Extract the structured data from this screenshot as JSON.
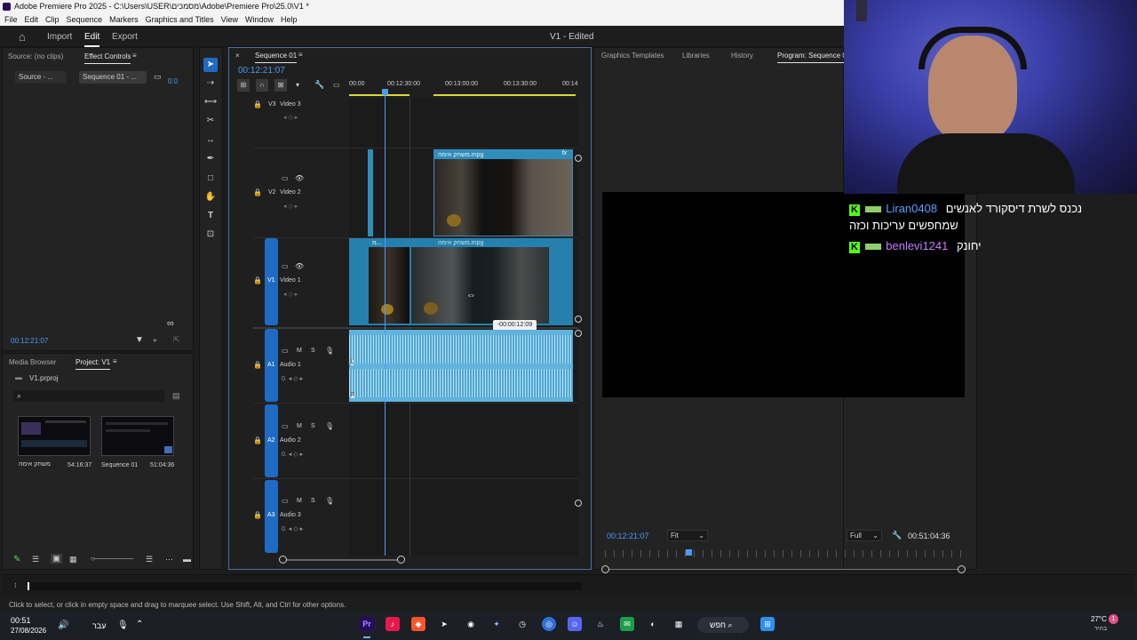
{
  "window": {
    "title": "Adobe Premiere Pro 2025 - C:\\Users\\USER\\מסמכים\\Adobe\\Premiere Pro\\25.0\\V1 *"
  },
  "menu": [
    "File",
    "Edit",
    "Clip",
    "Sequence",
    "Markers",
    "Graphics and Titles",
    "View",
    "Window",
    "Help"
  ],
  "workspace_tabs": {
    "import": "Import",
    "edit": "Edit",
    "export": "Export",
    "project_state": "V1 - Edited"
  },
  "source_panel": {
    "tab_source": "Source: (no clips)",
    "tab_effect": "Effect Controls",
    "source_drop": "Source - ...",
    "seq_drop": "Sequence 01 - ...",
    "timecode": "00:12:21:07",
    "edge_tc": "0:0"
  },
  "project_panel": {
    "tab_media": "Media Browser",
    "tab_project": "Project: V1",
    "file": "V1.prproj",
    "items": [
      {
        "name": "משחק אימה",
        "duration": "54:16:37"
      },
      {
        "name": "Sequence 01",
        "duration": "51:04:36"
      }
    ]
  },
  "timeline": {
    "tab": "Sequence 01",
    "timecode": "00:12:21:07",
    "ruler": [
      "00:00",
      "00:12:30:00",
      "00:13:00:00",
      "00:13:30:00",
      "00:14"
    ],
    "tracks": [
      {
        "id": "V3",
        "name": "Video 3"
      },
      {
        "id": "V2",
        "name": "Video 2"
      },
      {
        "id": "V1",
        "name": "Video 1"
      },
      {
        "id": "A1",
        "name": "Audio 1"
      },
      {
        "id": "A2",
        "name": "Audio 2"
      },
      {
        "id": "A3",
        "name": "Audio 3"
      }
    ],
    "clip_v2": "משחק אימה.mpg",
    "clip_v1": "משחק אימה.mpg",
    "clip_small": "מ...",
    "tooltip": "-00:00:12:09",
    "fx": "fx"
  },
  "program": {
    "tabs": [
      "Graphics Templates",
      "Libraries",
      "History",
      "Program: Sequence 01"
    ],
    "timecode": "00:12:21:07",
    "fit": "Fit",
    "quality": "Full",
    "duration": "00:51:04:36"
  },
  "chat": [
    {
      "user": "Liran0408",
      "text": "נכנס לשרת דיסקורד לאנשים",
      "text2": "שמחפשים עריכות וכזה",
      "color": "#5aa0ff"
    },
    {
      "user": "benlevi1241",
      "text": "יחונק",
      "color": "#c97cff"
    }
  ],
  "status": {
    "hint": "Click to select, or click in empty space and drag to marquee select. Use Shift, Alt, and Ctrl for other options."
  },
  "taskbar": {
    "time": "00:51",
    "date": "27/08/2026",
    "lang": "עבר",
    "search": "חפש",
    "weather": "27°C",
    "weather_sub": "בהיר",
    "notif": "1"
  }
}
